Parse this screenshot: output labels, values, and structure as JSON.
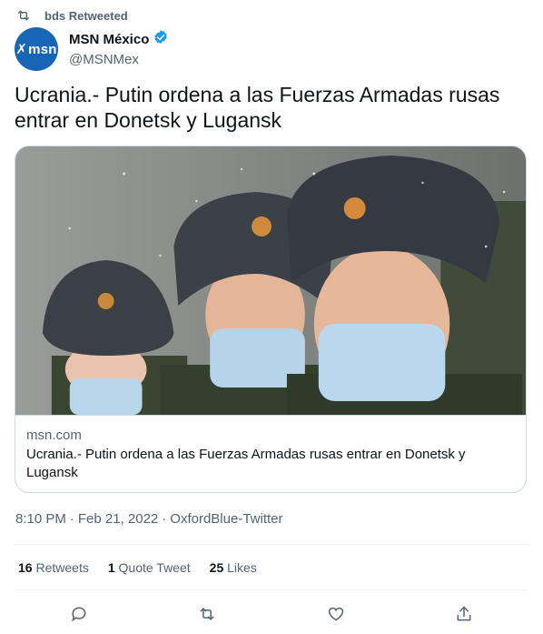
{
  "retweet": {
    "label": "bds Retweeted"
  },
  "author": {
    "avatar_text": "msn",
    "display_name": "MSN México",
    "handle": "@MSNMex",
    "verified_color": "#1d9bf0"
  },
  "tweet": {
    "text": "Ucrania.- Putin ordena a las Fuerzas Armadas rusas entrar en Donetsk y Lugansk"
  },
  "card": {
    "image_icon": "soldiers-photo",
    "domain": "msn.com",
    "title": "Ucrania.- Putin ordena a las Fuerzas Armadas rusas entrar en Donetsk y Lugansk"
  },
  "meta": {
    "time": "8:10 PM",
    "date": "Feb 21, 2022",
    "source": "OxfordBlue-Twitter",
    "separator": "·"
  },
  "stats": {
    "retweets_count": "16",
    "retweets_label": "Retweets",
    "quote_count": "1",
    "quote_label": "Quote Tweet",
    "likes_count": "25",
    "likes_label": "Likes"
  },
  "actions": [
    "reply-icon",
    "retweet-icon",
    "like-icon",
    "share-icon"
  ],
  "colors": {
    "secondary_text": "#536471",
    "border": "#cfd9de",
    "avatar_bg": "#1766b5"
  }
}
